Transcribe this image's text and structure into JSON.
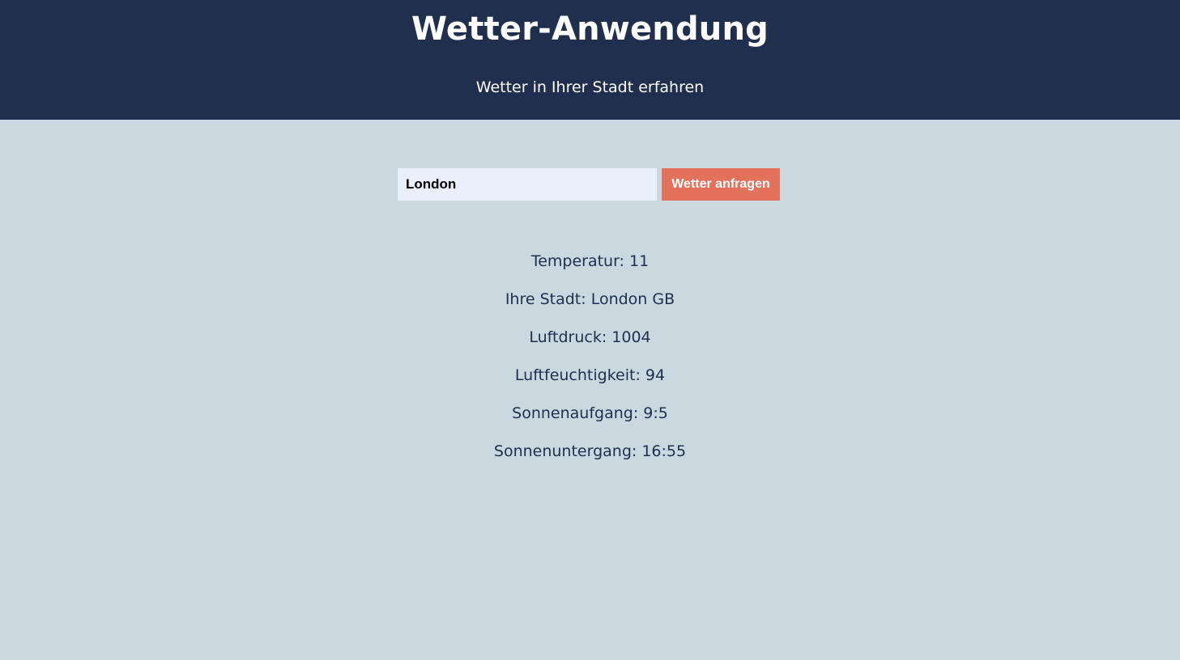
{
  "header": {
    "title": "Wetter-Anwendung",
    "subtitle": "Wetter in Ihrer Stadt erfahren"
  },
  "search": {
    "value": "London",
    "button_label": "Wetter anfragen"
  },
  "results": [
    "Temperatur: 11",
    "Ihre Stadt: London GB",
    "Luftdruck: 1004",
    "Luftfeuchtigkeit: 94",
    "Sonnenaufgang: 9:5",
    "Sonnenuntergang: 16:55"
  ],
  "colors": {
    "header_bg": "#1f2f4d",
    "page_bg": "#cbd8e0",
    "input_bg": "#e8f0fb",
    "button_bg": "#e2725b",
    "text": "#1f2f4d"
  }
}
